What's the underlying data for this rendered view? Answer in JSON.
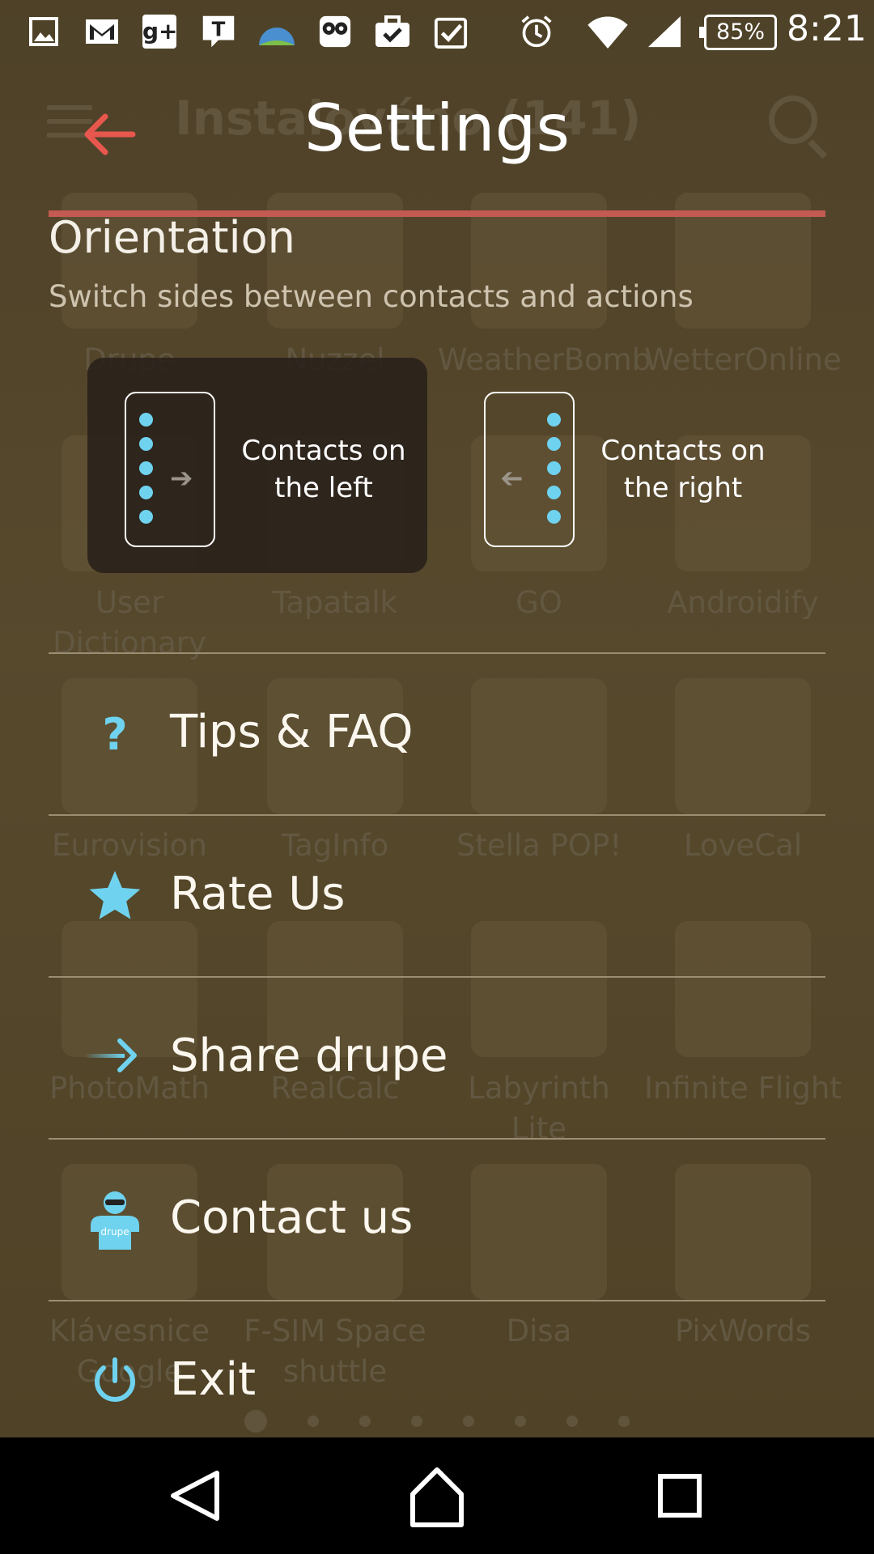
{
  "status_bar": {
    "time": "8:21",
    "battery": "85%",
    "icons": [
      "gallery-icon",
      "gmail-icon",
      "google-plus-icon",
      "t-app-icon",
      "weather-icon",
      "owl-icon",
      "briefcase-check-icon",
      "clipboard-check-icon",
      "alarm-icon",
      "wifi-icon",
      "signal-icon",
      "battery-icon"
    ]
  },
  "background": {
    "title": "Instalováno (141)",
    "apps": [
      {
        "label": "Drupe"
      },
      {
        "label": "Nuzzel"
      },
      {
        "label": "WeatherBomb"
      },
      {
        "label": "WetterOnline"
      },
      {
        "label": "User Dictionary"
      },
      {
        "label": "Tapatalk"
      },
      {
        "label": "GO"
      },
      {
        "label": "Androidify"
      },
      {
        "label": "Eurovision"
      },
      {
        "label": "TagInfo"
      },
      {
        "label": "Stella POP!"
      },
      {
        "label": "LoveCal"
      },
      {
        "label": "PhotoMath"
      },
      {
        "label": "RealCalc"
      },
      {
        "label": "Labyrinth Lite"
      },
      {
        "label": "Infinite Flight"
      },
      {
        "label": "Klávesnice Google"
      },
      {
        "label": "F-SIM Space shuttle"
      },
      {
        "label": "Disa"
      },
      {
        "label": "PixWords"
      }
    ],
    "page_count": 8,
    "active_page": 1
  },
  "settings": {
    "title": "Settings",
    "accent_color": "#c45a52",
    "icon_color": "#6fd2ee",
    "orientation": {
      "title": "Orientation",
      "subtitle": "Switch sides between contacts and actions",
      "options": [
        {
          "label": "Contacts on the left",
          "selected": true
        },
        {
          "label": "Contacts on the right",
          "selected": false
        }
      ]
    },
    "menu": [
      {
        "label": "Tips & FAQ",
        "icon": "question-icon"
      },
      {
        "label": "Rate Us",
        "icon": "star-icon"
      },
      {
        "label": "Share drupe",
        "icon": "share-arrow-icon"
      },
      {
        "label": "Contact us",
        "icon": "drupe-person-icon"
      },
      {
        "label": "Exit",
        "icon": "power-icon"
      }
    ]
  },
  "nav_bar": {
    "buttons": [
      "back-nav-icon",
      "home-nav-icon",
      "recents-nav-icon"
    ]
  }
}
